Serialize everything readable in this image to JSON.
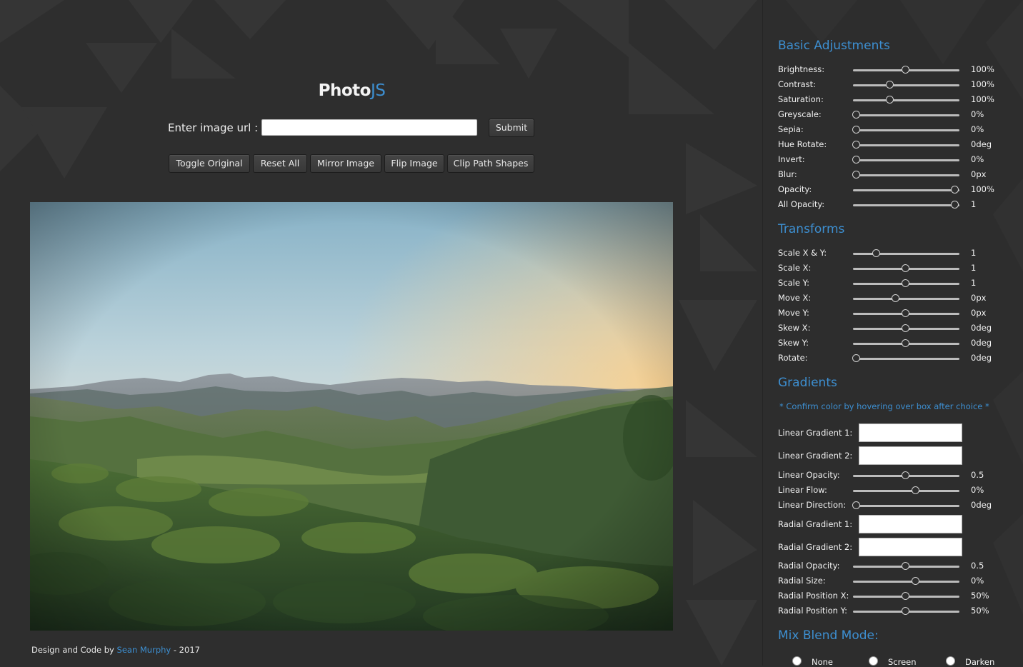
{
  "app": {
    "logo_main": "Photo",
    "logo_accent": "JS",
    "url_label": "Enter image url :",
    "url_value": "",
    "submit_label": "Submit"
  },
  "toolbar": {
    "toggle_original": "Toggle Original",
    "reset_all": "Reset All",
    "mirror_image": "Mirror Image",
    "flip_image": "Flip Image",
    "clip_path_shapes": "Clip Path Shapes"
  },
  "footer": {
    "prefix": "Design and Code by",
    "author": "Sean Murphy",
    "suffix": "- 2017"
  },
  "colors": {
    "accent": "#3d8fd1",
    "background": "#2e2e2e"
  },
  "panel": {
    "basic_title": "Basic Adjustments",
    "basic": [
      {
        "label": "Brightness:",
        "value": "100%",
        "level": 0.5
      },
      {
        "label": "Contrast:",
        "value": "100%",
        "level": 0.34
      },
      {
        "label": "Saturation:",
        "value": "100%",
        "level": 0.34
      },
      {
        "label": "Greyscale:",
        "value": "0%",
        "level": 0
      },
      {
        "label": "Sepia:",
        "value": "0%",
        "level": 0
      },
      {
        "label": "Hue Rotate:",
        "value": "0deg",
        "level": 0
      },
      {
        "label": "Invert:",
        "value": "0%",
        "level": 0
      },
      {
        "label": "Blur:",
        "value": "0px",
        "level": 0
      },
      {
        "label": "Opacity:",
        "value": "100%",
        "level": 1
      },
      {
        "label": "All Opacity:",
        "value": "1",
        "level": 1
      }
    ],
    "transforms_title": "Transforms",
    "transforms": [
      {
        "label": "Scale X & Y:",
        "value": "1",
        "level": 0.2
      },
      {
        "label": "Scale X:",
        "value": "1",
        "level": 0.5
      },
      {
        "label": "Scale Y:",
        "value": "1",
        "level": 0.5
      },
      {
        "label": "Move X:",
        "value": "0px",
        "level": 0.4
      },
      {
        "label": "Move Y:",
        "value": "0px",
        "level": 0.5
      },
      {
        "label": "Skew X:",
        "value": "0deg",
        "level": 0.5
      },
      {
        "label": "Skew Y:",
        "value": "0deg",
        "level": 0.5
      },
      {
        "label": "Rotate:",
        "value": "0deg",
        "level": 0
      }
    ],
    "gradients_title": "Gradients",
    "gradients_note": "* Confirm color by hovering over box after choice *",
    "linear_gradient_1": "Linear Gradient 1:",
    "linear_gradient_2": "Linear Gradient 2:",
    "linear_sliders": [
      {
        "label": "Linear Opacity:",
        "value": "0.5",
        "level": 0.5
      },
      {
        "label": "Linear Flow:",
        "value": "0%",
        "level": 0.6
      },
      {
        "label": "Linear Direction:",
        "value": "0deg",
        "level": 0
      }
    ],
    "radial_gradient_1": "Radial Gradient 1:",
    "radial_gradient_2": "Radial Gradient 2:",
    "radial_sliders": [
      {
        "label": "Radial Opacity:",
        "value": "0.5",
        "level": 0.5
      },
      {
        "label": "Radial Size:",
        "value": "0%",
        "level": 0.6
      },
      {
        "label": "Radial Position X:",
        "value": "50%",
        "level": 0.5
      },
      {
        "label": "Radial Position Y:",
        "value": "50%",
        "level": 0.5
      }
    ],
    "blend_title": "Mix Blend Mode:",
    "blend_options": [
      "None",
      "Screen",
      "Darken"
    ]
  }
}
